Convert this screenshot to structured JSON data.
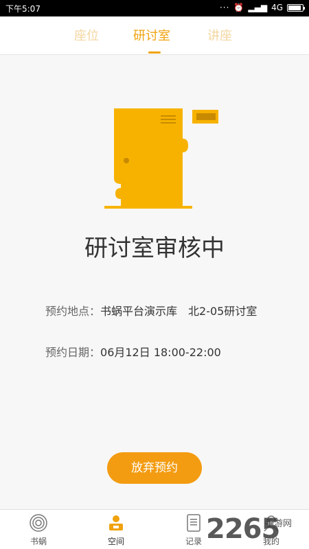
{
  "status_bar": {
    "time": "下午5:07",
    "network": "4G"
  },
  "tabs": [
    {
      "label": "座位",
      "active": false
    },
    {
      "label": "研讨室",
      "active": true
    },
    {
      "label": "讲座",
      "active": false
    }
  ],
  "illustration": {
    "icon": "door-icon",
    "color": "#f7b200"
  },
  "headline": "研讨室审核中",
  "info": {
    "location_label": "预约地点：",
    "location_value": "书蜗平台演示库　北2-05研讨室",
    "date_label": "预约日期：",
    "date_value": "06月12日 18:00-22:00"
  },
  "cancel_button": "放弃预约",
  "nav": [
    {
      "label": "书蜗",
      "icon": "snail-icon",
      "active": false
    },
    {
      "label": "空间",
      "icon": "space-icon",
      "active": true
    },
    {
      "label": "记录",
      "icon": "record-icon",
      "active": false
    },
    {
      "label": "我的",
      "icon": "profile-icon",
      "active": false
    }
  ],
  "watermark": {
    "text": "2265",
    "sub": "手游网"
  },
  "colors": {
    "accent": "#f0a20d",
    "button": "#f39c12",
    "inactive_tab": "#f3d6a0"
  }
}
